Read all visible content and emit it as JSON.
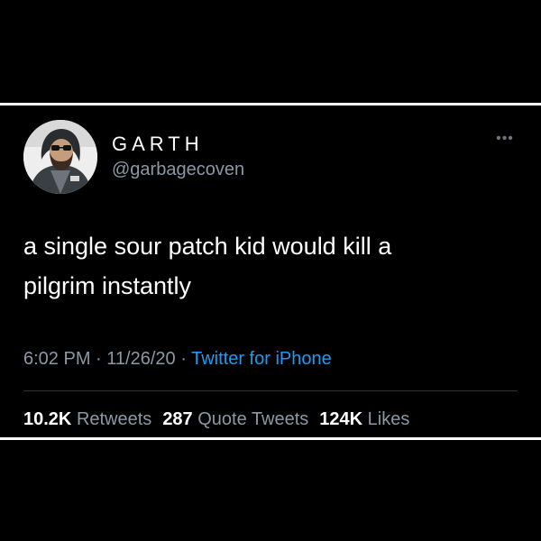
{
  "tweet": {
    "author_name": "GARTH",
    "author_handle": "@garbagecoven",
    "more_icon": "more-dots-icon",
    "text_line1": "a single sour patch kid would kill a",
    "text_line2": "pilgrim instantly",
    "time": "6:02 PM",
    "separator": "·",
    "date": "11/26/20",
    "source": "Twitter for iPhone",
    "stats": {
      "retweets_count": "10.2K",
      "retweets_label": "Retweets",
      "quotes_count": "287",
      "quotes_label": "Quote Tweets",
      "likes_count": "124K",
      "likes_label": "Likes"
    }
  },
  "colors": {
    "background": "#000000",
    "text": "#ffffff",
    "secondary": "#8b98a5",
    "link": "#1d9bf0",
    "frame_rule": "#ffffff"
  }
}
